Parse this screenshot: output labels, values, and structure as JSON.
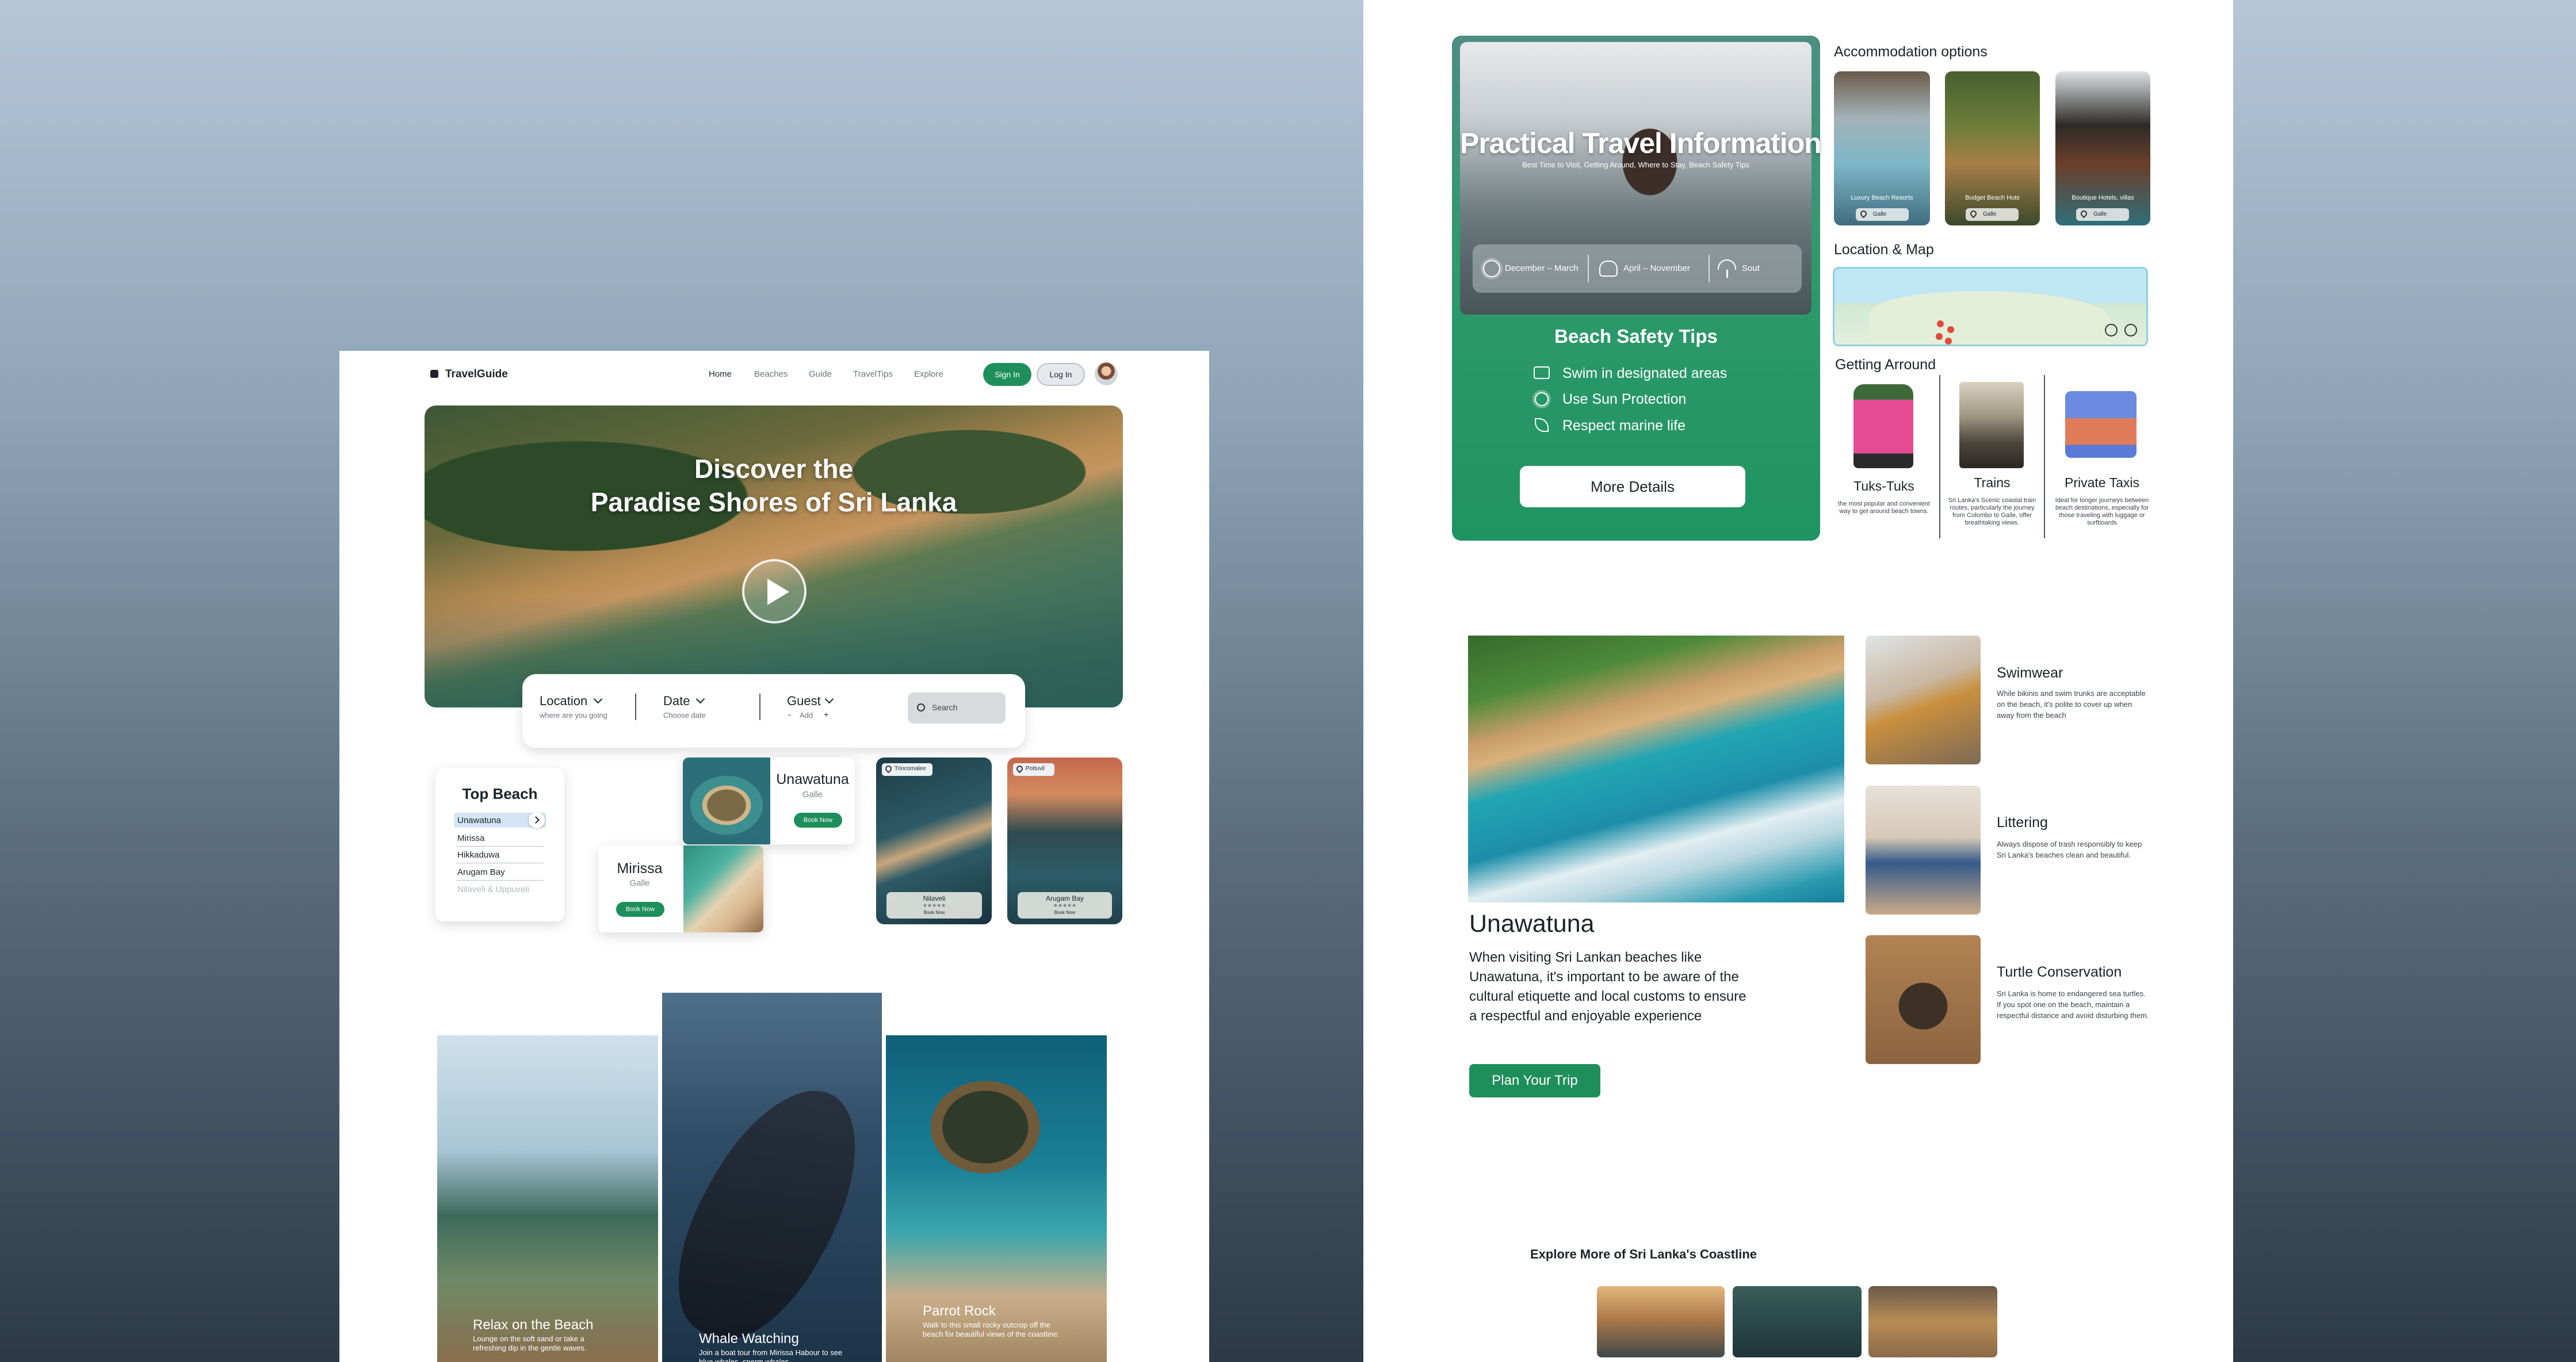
{
  "colors": {
    "accent": "#1e8f5b",
    "accent_dark": "#17794c",
    "nav_active": "#1c2329"
  },
  "left": {
    "brand": "TravelGuide",
    "nav": [
      "Home",
      "Beaches",
      "Guide",
      "TravelTips",
      "Explore"
    ],
    "sign_in": "Sign In",
    "log_in": "Log In",
    "hero": {
      "title_line1": "Discover the",
      "title_line2": "Paradise Shores of Sri Lanka"
    },
    "search": {
      "location_label": "Location",
      "location_sub": "where are you going",
      "date_label": "Date",
      "date_sub": "Choose date",
      "guest_label": "Guest",
      "guest_minus": "-",
      "guest_add": "Add",
      "guest_plus": "+",
      "search_placeholder": "Search"
    },
    "top_beach": {
      "title": "Top Beach",
      "items": [
        "Unawatuna",
        "Mirissa",
        "Hikkaduwa",
        "Arugam Bay",
        "Nilaveli & Uppuveli"
      ]
    },
    "cards": [
      {
        "name": "Unawatuna",
        "loc": "Galle",
        "btn": "Book Now"
      },
      {
        "name": "Mirissa",
        "loc": "Galle",
        "btn": "Book Now"
      }
    ],
    "tall_cards": [
      {
        "badge": "Trincomalee",
        "name": "Nilaveli",
        "stars": "★★★★★",
        "btn": "Book Now"
      },
      {
        "badge": "Pottuvil",
        "name": "Arugam Bay",
        "stars": "★★★★★",
        "btn": "Book Now"
      }
    ],
    "activities": [
      {
        "title": "Relax on the Beach",
        "desc": "Lounge on the soft sand or take a refreshing dip in the gentle waves."
      },
      {
        "title": "Whale Watching",
        "desc": "Join a boat tour from Mirissa Habour to see blue whales, sperm whales"
      },
      {
        "title": "Parrot Rock",
        "desc": "Walk to this small rocky outcrop off the beach for beautiful views of the coastline."
      }
    ]
  },
  "right": {
    "practical": {
      "title": "Practical Travel Information",
      "subtitle": "Best Time to Visit, Getting Around, Where to Stay, Beach Safety Tips",
      "seasons": [
        "December – March",
        "April – November",
        "Sout"
      ]
    },
    "safety": {
      "title": "Beach Safety Tips",
      "tips": [
        "Swim in designated areas",
        "Use Sun Protection",
        "Respect marine life"
      ],
      "btn": "More Details"
    },
    "accommodation": {
      "title": "Accommodation options",
      "items": [
        {
          "label": "Luxury Beach Resorts",
          "loc": "Galle"
        },
        {
          "label": "Budget Beach Huts",
          "loc": "Galle"
        },
        {
          "label": "Boutique Hotels, villas",
          "loc": "Galle"
        }
      ]
    },
    "location_title": "Location & Map",
    "getting_around": {
      "title": "Getting Arround",
      "items": [
        {
          "name": "Tuks-Tuks",
          "desc": "the most popular and convenient way to get around beach towns."
        },
        {
          "name": "Trains",
          "desc": "Sri Lanka's Scenic coastal train routes, particularly the journey from Colombo to Galle, offer breathtaking views."
        },
        {
          "name": "Private Taxis",
          "desc": "Ideal for longer journeys between beach destinations, especially for those traveling with luggage or surfboards"
        }
      ]
    },
    "unawatuna": {
      "title": "Unawatuna",
      "desc": "When visiting Sri Lankan beaches like Unawatuna, it's important to be aware of the cultural etiquette and local customs to ensure a respectful and enjoyable experience",
      "btn": "Plan Your Trip"
    },
    "etiquette": [
      {
        "title": "Swimwear",
        "desc": "While bikinis and swim trunks are acceptable on the beach, it's polite to cover up when away from the beach"
      },
      {
        "title": "Littering",
        "desc": "Always dispose of trash responsibly to keep Sri Lanka's beaches clean and beautiful."
      },
      {
        "title": "Turtle Conservation",
        "desc": "Sri Lanka is home to endangered sea turtles. If you spot one on the beach, maintain a respectful distance and avoid disturbing them."
      }
    ],
    "explore_title": "Explore More of Sri Lanka's Coastline"
  }
}
